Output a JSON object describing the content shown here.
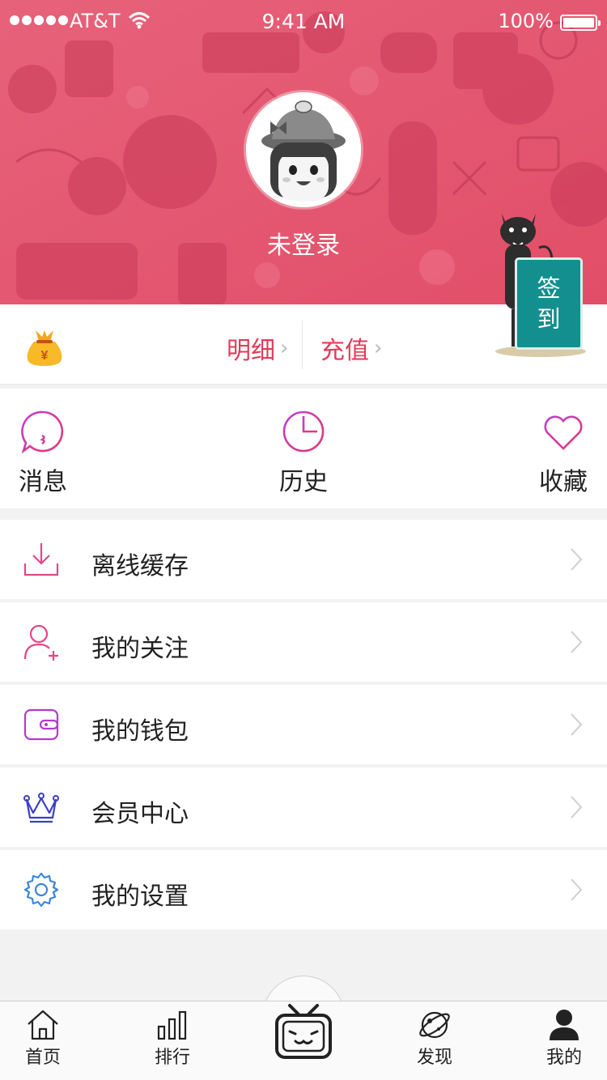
{
  "status_bar": {
    "carrier": "AT&T",
    "time": "9:41 AM",
    "battery": "100%"
  },
  "profile": {
    "username": "未登录"
  },
  "wallet": {
    "detail_label": "明细",
    "recharge_label": "充值",
    "checkin_line1": "签",
    "checkin_line2": "到"
  },
  "quick_actions": [
    {
      "label": "消息",
      "icon": "kiss-face-icon"
    },
    {
      "label": "历史",
      "icon": "clock-icon"
    },
    {
      "label": "收藏",
      "icon": "heart-icon"
    }
  ],
  "menu": [
    {
      "label": "离线缓存",
      "icon": "download-icon"
    },
    {
      "label": "我的关注",
      "icon": "add-user-icon"
    },
    {
      "label": "我的钱包",
      "icon": "wallet-icon"
    },
    {
      "label": "会员中心",
      "icon": "crown-icon"
    },
    {
      "label": "我的设置",
      "icon": "gear-icon"
    }
  ],
  "tabbar": [
    {
      "label": "首页",
      "icon": "home-icon"
    },
    {
      "label": "排行",
      "icon": "bar-chart-icon"
    },
    {
      "label": "",
      "icon": "tv-icon"
    },
    {
      "label": "发现",
      "icon": "planet-icon"
    },
    {
      "label": "我的",
      "icon": "person-icon"
    }
  ],
  "colors": {
    "header_bg": "#e5566e",
    "accent_red": "#e23b58",
    "checkin_green": "#138f8f"
  }
}
